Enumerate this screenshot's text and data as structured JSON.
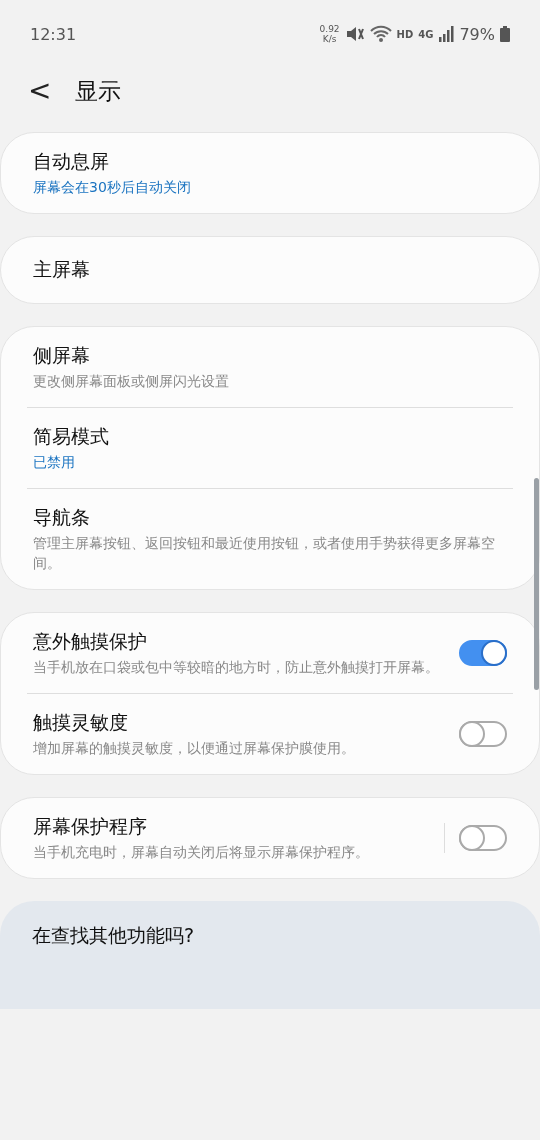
{
  "status_bar": {
    "time": "12:31",
    "speed_value": "0.92",
    "speed_unit": "K/s",
    "hd": "HD",
    "network": "4G",
    "battery": "79%"
  },
  "header": {
    "back": "<",
    "title": "显示"
  },
  "cards": [
    {
      "rows": [
        {
          "title": "自动息屏",
          "subtitle": "屏幕会在30秒后自动关闭",
          "highlighted": true
        }
      ]
    },
    {
      "rows": [
        {
          "title": "主屏幕"
        }
      ]
    },
    {
      "rows": [
        {
          "title": "侧屏幕",
          "subtitle": "更改侧屏幕面板或侧屏闪光设置",
          "highlighted": false
        },
        {
          "title": "简易模式",
          "subtitle": "已禁用",
          "highlighted": true
        },
        {
          "title": "导航条",
          "subtitle": "管理主屏幕按钮、返回按钮和最近使用按钮，或者使用手势获得更多屏幕空间。",
          "highlighted": false
        }
      ]
    },
    {
      "rows": [
        {
          "title": "意外触摸保护",
          "subtitle": "当手机放在口袋或包中等较暗的地方时，防止意外触摸打开屏幕。",
          "highlighted": false,
          "kind": "toggle",
          "on": true,
          "split": false
        },
        {
          "title": "触摸灵敏度",
          "subtitle": "增加屏幕的触摸灵敏度，以便通过屏幕保护膜使用。",
          "highlighted": false,
          "kind": "toggle",
          "on": false,
          "split": false
        }
      ]
    },
    {
      "rows": [
        {
          "title": "屏幕保护程序",
          "subtitle": "当手机充电时，屏幕自动关闭后将显示屏幕保护程序。",
          "highlighted": false,
          "kind": "toggle",
          "on": false,
          "split": true
        }
      ]
    }
  ],
  "suggestion": {
    "title": "在查找其他功能吗?"
  }
}
